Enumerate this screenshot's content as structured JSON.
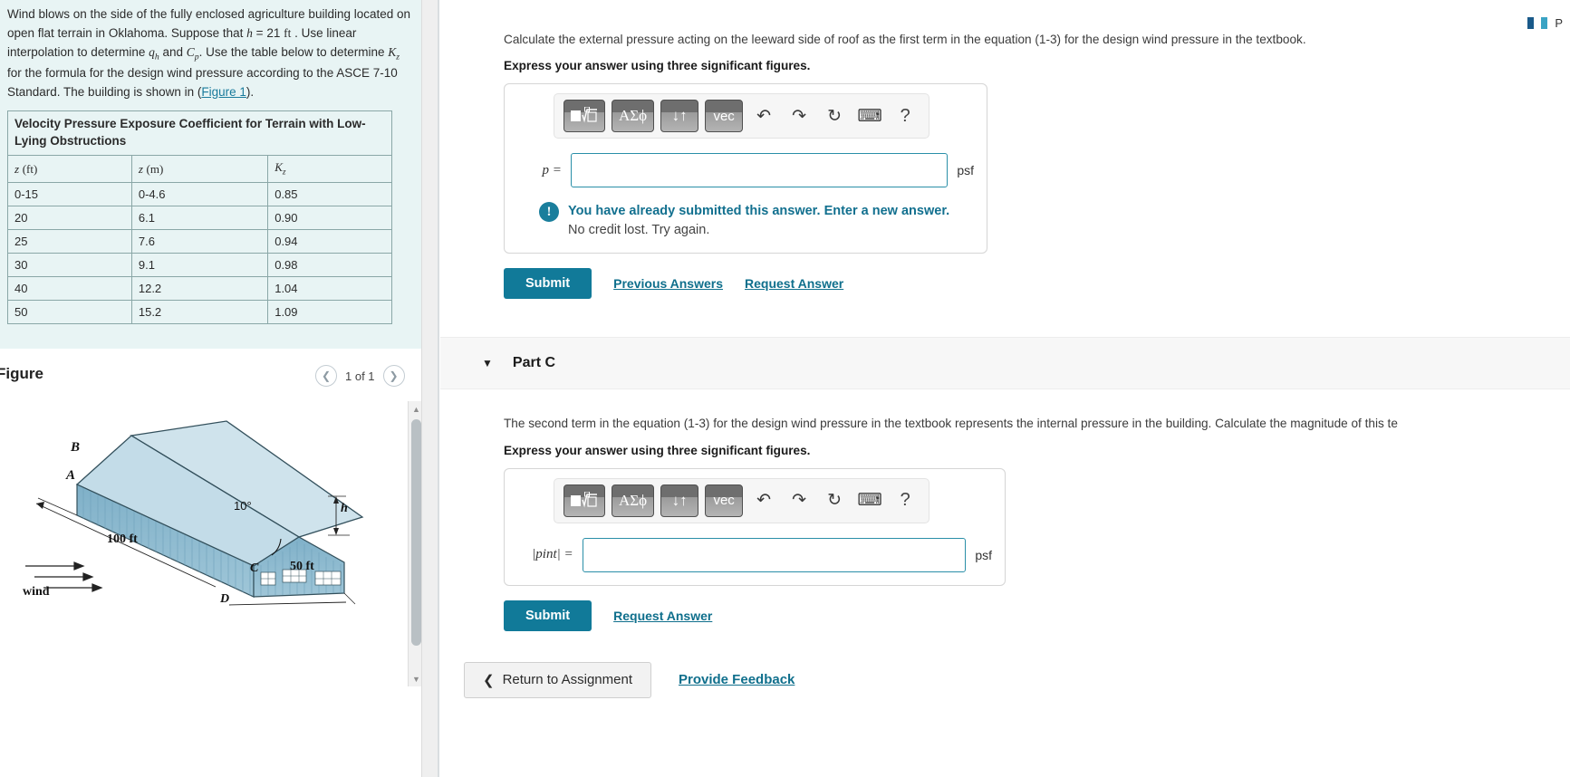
{
  "problem": {
    "lines": [
      "Wind blows on the side of the fully enclosed agriculture building",
      "located on open flat terrain in Oklahoma. Suppose that h = 21 ft .",
      "Use linear interpolation to determine qh and Cp. Use the table below",
      "to determine Kz for the formula for the design wind pressure",
      "according to the ASCE 7-10 Standard. The building is shown in",
      "(Figure 1)."
    ],
    "figure_link": "Figure 1",
    "h_value": "21",
    "h_unit": "ft"
  },
  "table": {
    "title": "Velocity Pressure Exposure Coefficient for Terrain with Low-Lying Obstructions",
    "headers": [
      "z (ft)",
      "z (m)",
      "Kz"
    ],
    "rows": [
      [
        "0-15",
        "0-4.6",
        "0.85"
      ],
      [
        "20",
        "6.1",
        "0.90"
      ],
      [
        "25",
        "7.6",
        "0.94"
      ],
      [
        "30",
        "9.1",
        "0.98"
      ],
      [
        "40",
        "12.2",
        "1.04"
      ],
      [
        "50",
        "15.2",
        "1.09"
      ]
    ]
  },
  "figure": {
    "label": "Figure",
    "pager_text": "1 of 1",
    "prev_icon": "chevron-left-icon",
    "next_icon": "chevron-right-icon",
    "annotations": {
      "point_a": "A",
      "point_b": "B",
      "point_c": "C",
      "point_d": "D",
      "angle": "10°",
      "length": "100 ft",
      "width": "50 ft",
      "height_symbol": "h",
      "wind_label": "wind"
    }
  },
  "part_b": {
    "prompt": "Calculate the external pressure acting on the leeward side of roof as the first term in the equation (1-3) for the design wind pressure in the textbook.",
    "instruction": "Express your answer using three significant figures.",
    "answer_symbol": "p",
    "answer_value": "",
    "unit": "psf",
    "alert_main": "You have already submitted this answer. Enter a new answer.",
    "alert_sub": "No credit lost. Try again.",
    "submit_label": "Submit",
    "previous_answers_label": "Previous Answers",
    "request_answer_label": "Request Answer"
  },
  "part_c": {
    "title": "Part C",
    "prompt": "The second term in the equation (1-3) for the design wind pressure in the textbook represents the internal pressure in the building. Calculate the magnitude of this te",
    "instruction": "Express your answer using three significant figures.",
    "answer_symbol": "|pint| =",
    "answer_value": "",
    "unit": "psf",
    "submit_label": "Submit",
    "request_answer_label": "Request Answer"
  },
  "footer": {
    "return_label": "Return to Assignment",
    "back_icon": "chevron-left-icon",
    "feedback_label": "Provide Feedback"
  },
  "toolbar": {
    "keys": [
      {
        "name": "template-math-key",
        "glyph": "■√□"
      },
      {
        "name": "greek-letters-key",
        "glyph": "ΑΣϕ"
      },
      {
        "name": "arrows-key",
        "glyph": "↓↑"
      },
      {
        "name": "vector-key",
        "glyph": "vec"
      }
    ],
    "icons": [
      {
        "name": "undo-icon",
        "glyph": "↶"
      },
      {
        "name": "redo-icon",
        "glyph": "↷"
      },
      {
        "name": "reset-icon",
        "glyph": "↻"
      },
      {
        "name": "keyboard-icon",
        "glyph": "⌨"
      },
      {
        "name": "help-icon",
        "glyph": "?"
      }
    ]
  },
  "colors": {
    "accent": "#117a99",
    "link": "#0f6f8c",
    "problem_bg": "#e8f4f4",
    "part_header_bg": "#f7f7f7"
  }
}
